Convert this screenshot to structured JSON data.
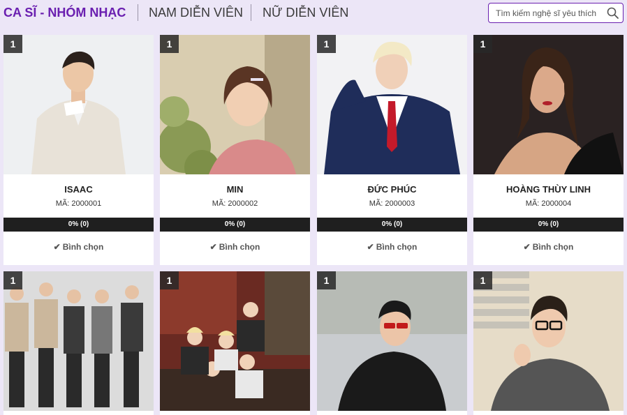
{
  "tabs": [
    {
      "label": "CA SĨ - NHÓM NHẠC",
      "active": true
    },
    {
      "label": "NAM DIỄN VIÊN",
      "active": false
    },
    {
      "label": "NỮ DIỄN VIÊN",
      "active": false
    }
  ],
  "search": {
    "placeholder": "Tìm kiếm nghệ sĩ yêu thích"
  },
  "colors": {
    "accent": "#6a1fb0",
    "background": "#ece6f7",
    "bar": "#1f1f1f"
  },
  "artists": [
    {
      "rank": "1",
      "name": "ISAAC",
      "code": "MÃ: 2000001",
      "vote_percent": 0,
      "vote_text": "0% (0)",
      "vote_label": "Bình chọn",
      "photo_icon": "artist-photo"
    },
    {
      "rank": "1",
      "name": "MIN",
      "code": "MÃ: 2000002",
      "vote_percent": 0,
      "vote_text": "0% (0)",
      "vote_label": "Bình chọn",
      "photo_icon": "artist-photo"
    },
    {
      "rank": "1",
      "name": "ĐỨC PHÚC",
      "code": "MÃ: 2000003",
      "vote_percent": 0,
      "vote_text": "0% (0)",
      "vote_label": "Bình chọn",
      "photo_icon": "artist-photo"
    },
    {
      "rank": "1",
      "name": "HOÀNG THÙY LINH",
      "code": "MÃ: 2000004",
      "vote_percent": 0,
      "vote_text": "0% (0)",
      "vote_label": "Bình chọn",
      "photo_icon": "artist-photo"
    },
    {
      "rank": "1",
      "photo_icon": "group-photo"
    },
    {
      "rank": "1",
      "photo_icon": "group-photo"
    },
    {
      "rank": "1",
      "photo_icon": "artist-photo"
    },
    {
      "rank": "1",
      "photo_icon": "artist-photo"
    }
  ]
}
